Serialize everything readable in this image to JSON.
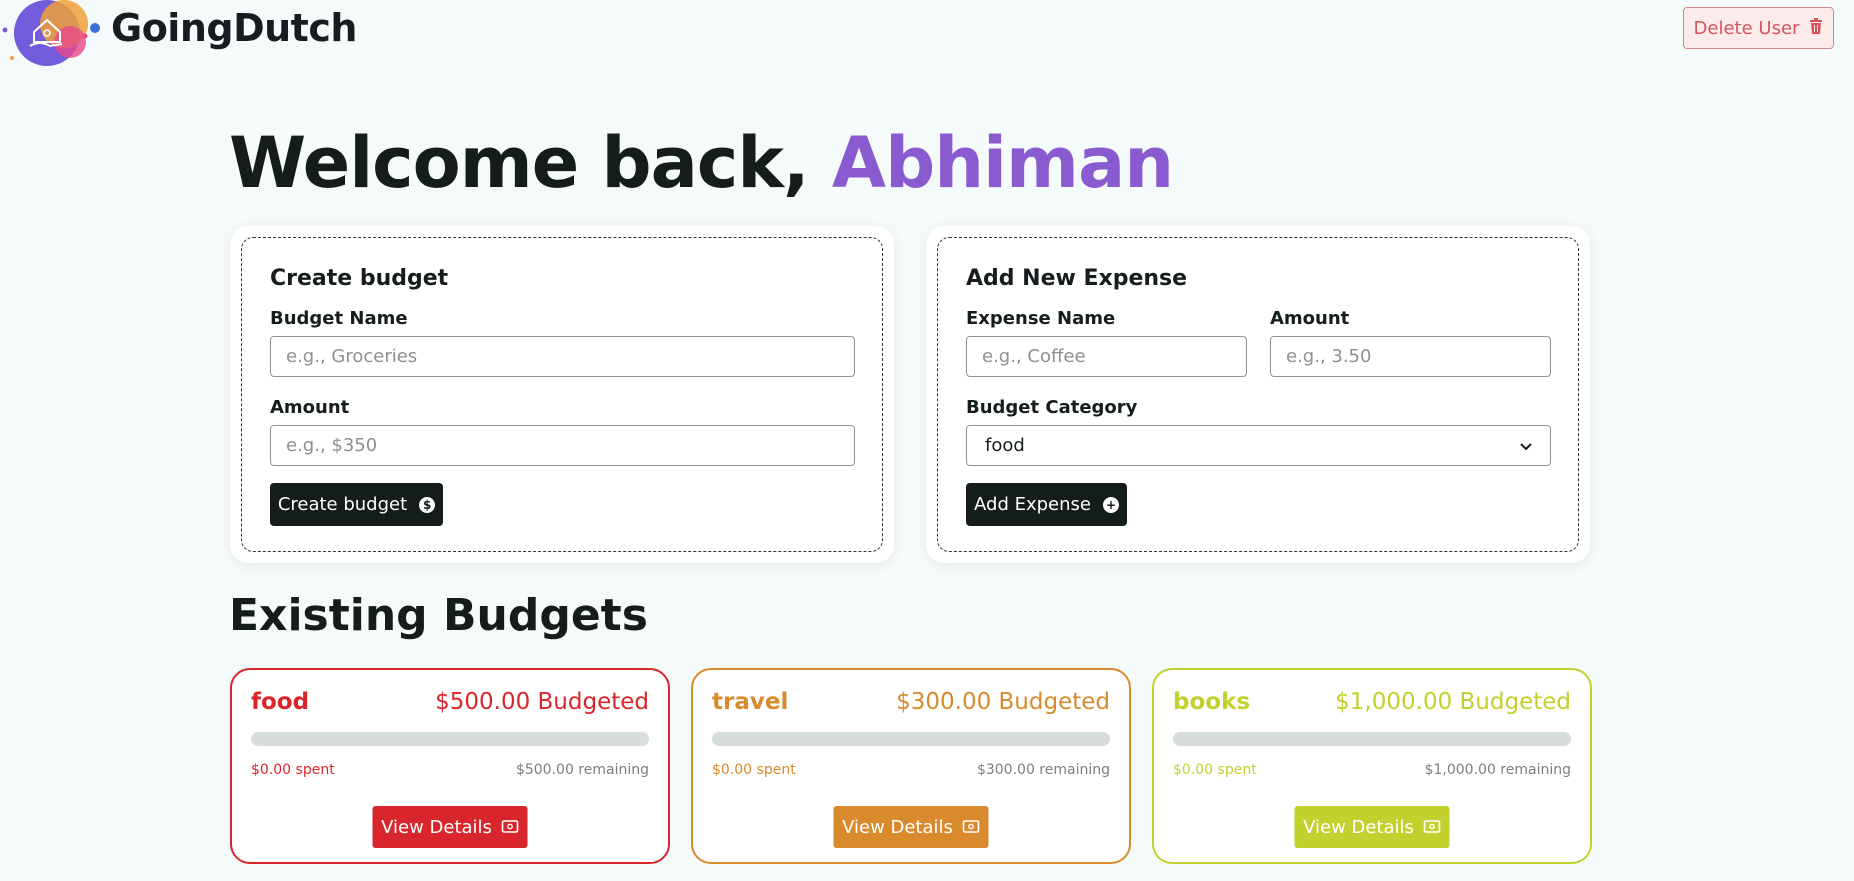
{
  "header": {
    "brand": "GoingDutch",
    "delete_label": "Delete User",
    "logo_icon": "house-hand-logo",
    "delete_icon": "trash-icon"
  },
  "welcome": {
    "prefix": "Welcome back, ",
    "name": "Abhiman",
    "name_color": "#8a5ad0"
  },
  "create_budget": {
    "title": "Create budget",
    "name_label": "Budget Name",
    "name_placeholder": "e.g., Groceries",
    "amount_label": "Amount",
    "amount_placeholder": "e.g., $350",
    "button_label": "Create budget",
    "button_icon": "dollar-circle-icon"
  },
  "add_expense": {
    "title": "Add New Expense",
    "name_label": "Expense Name",
    "name_placeholder": "e.g., Coffee",
    "amount_label": "Amount",
    "amount_placeholder": "e.g., 3.50",
    "category_label": "Budget Category",
    "category_selected": "food",
    "button_label": "Add Expense",
    "button_icon": "plus-circle-icon"
  },
  "existing": {
    "title": "Existing Budgets",
    "budgets": [
      {
        "name": "food",
        "budgeted": "$500.00 Budgeted",
        "spent": "$0.00 spent",
        "remaining": "$500.00 remaining",
        "progress": 0,
        "color": "#d9262c",
        "button_label": "View Details",
        "button_icon": "cash-icon"
      },
      {
        "name": "travel",
        "budgeted": "$300.00 Budgeted",
        "spent": "$0.00 spent",
        "remaining": "$300.00 remaining",
        "progress": 0,
        "color": "#d98a2c",
        "button_label": "View Details",
        "button_icon": "cash-icon"
      },
      {
        "name": "books",
        "budgeted": "$1,000.00 Budgeted",
        "spent": "$0.00 spent",
        "remaining": "$1,000.00 remaining",
        "progress": 0,
        "color": "#c2d12e",
        "button_label": "View Details",
        "button_icon": "cash-icon"
      }
    ]
  }
}
